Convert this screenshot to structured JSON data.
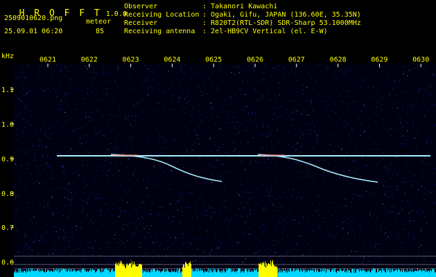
{
  "app": {
    "name": "H R O F F T",
    "version": "1.0.0"
  },
  "file": {
    "name": "2509010620.png",
    "datetime": "25.09.01 06:20"
  },
  "counter": {
    "label": "meteor",
    "value": "85"
  },
  "info": [
    {
      "label": "Observer",
      "value": ": Takanori Kawachi"
    },
    {
      "label": "Receiving Location",
      "value": ": Ogaki, Gifu, JAPAN (136.60E, 35.35N)"
    },
    {
      "label": "Receiver",
      "value": ": R820T2(RTL-SDR) SDR-Sharp 53.1000MHz"
    },
    {
      "label": "Receiving antenna",
      "value": ": 2el-HB9CV Vertical (el. E-W)"
    }
  ],
  "colors": {
    "text": "#ffff00",
    "background": "#000010",
    "noise": "#1a1f8c",
    "trace": "#a8f0ff",
    "bars": "#00d8ff",
    "bars_alt": "#ffff00"
  },
  "spectrogram": {
    "y_unit": "kHz",
    "y_ticks": [
      "1.1",
      "1.0",
      "0.9",
      "0.8",
      "0.7",
      "0.6"
    ],
    "x_ticks": [
      "0621",
      "0622",
      "0623",
      "0624",
      "0625",
      "0626",
      "0627",
      "0628",
      "0629",
      "0630"
    ]
  }
}
